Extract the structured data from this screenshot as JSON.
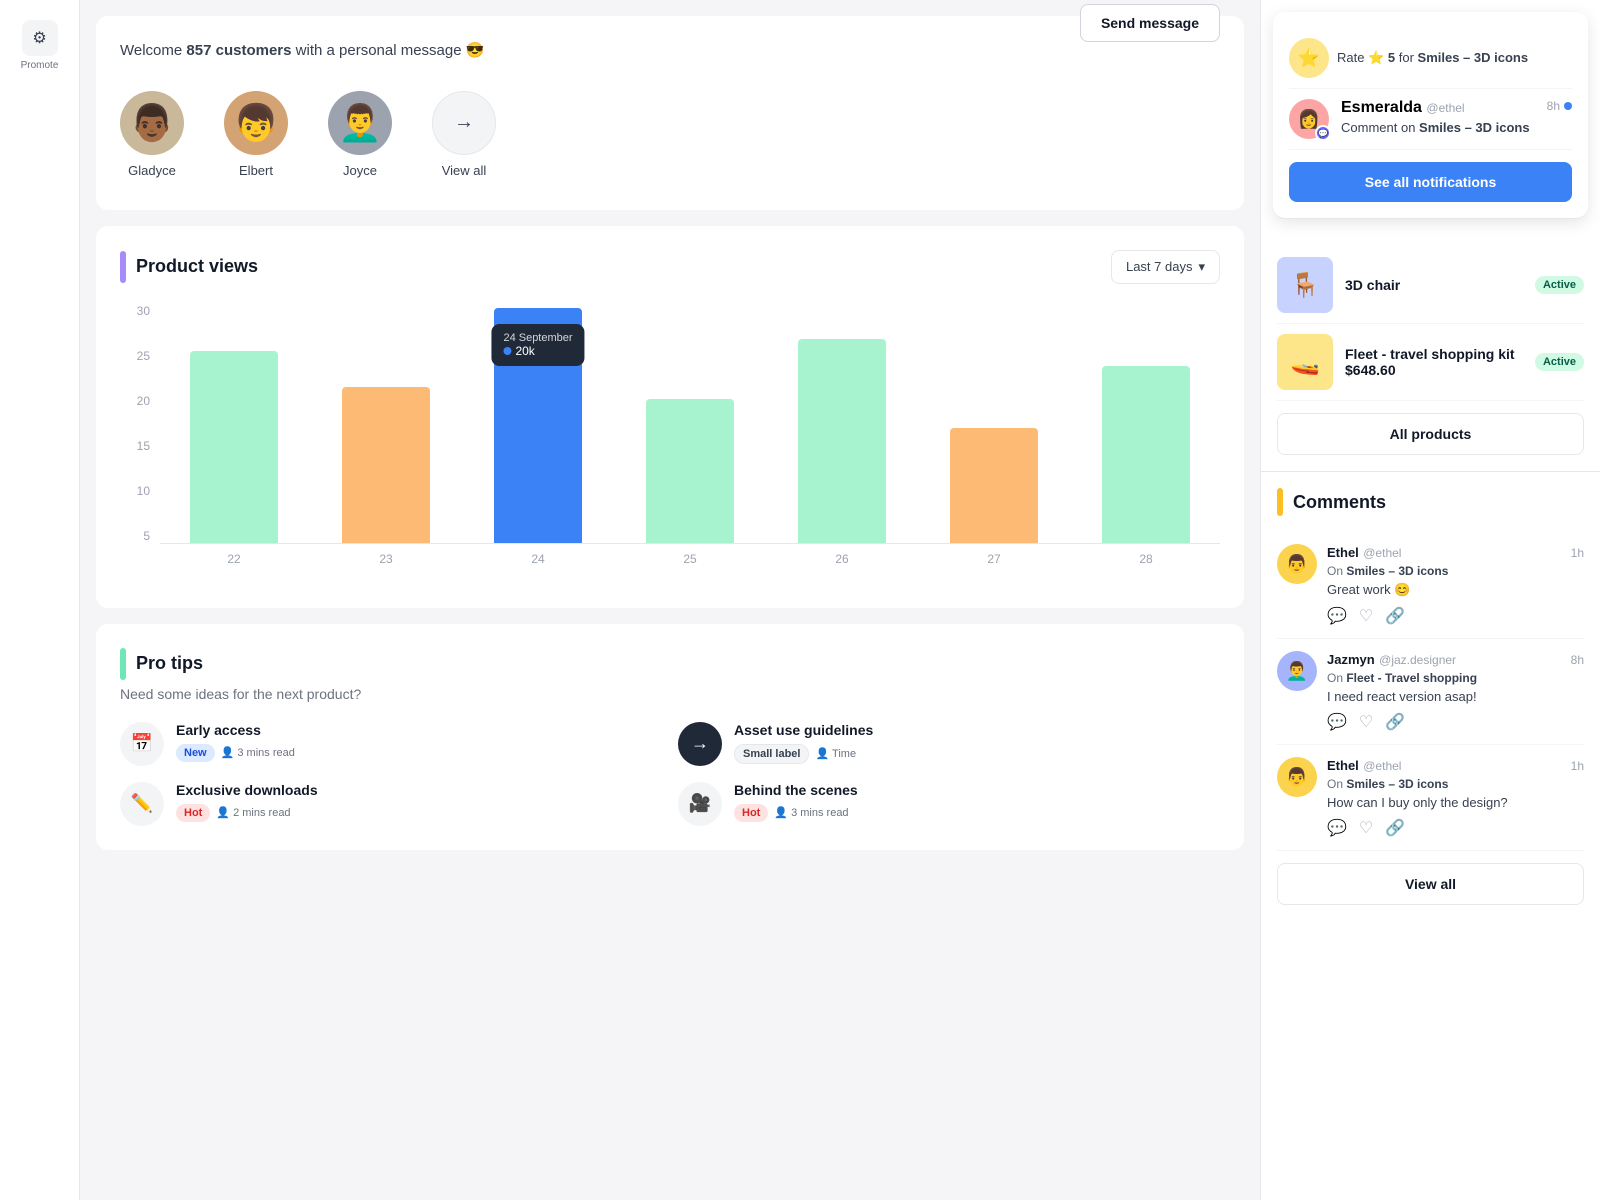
{
  "sidebar": {
    "logo_icon": "⚙",
    "label": "Promote"
  },
  "welcome": {
    "prefix": "Welcome",
    "count": "857 customers",
    "suffix": "with a personal message 😎",
    "send_button": "Send message",
    "avatars": [
      {
        "name": "Gladyce",
        "emoji": "👨🏾"
      },
      {
        "name": "Elbert",
        "emoji": "👦"
      },
      {
        "name": "Joyce",
        "emoji": "👨‍🦱"
      }
    ],
    "view_all_label": "View all"
  },
  "product_views": {
    "title": "Product views",
    "period": "Last 7 days",
    "tooltip": {
      "date": "24 September",
      "value": "20k"
    },
    "y_labels": [
      "5",
      "10",
      "15",
      "20",
      "25",
      "30"
    ],
    "bars": [
      {
        "day": "22",
        "height_pct": 84,
        "type": "green"
      },
      {
        "day": "23",
        "height_pct": 70,
        "type": "orange"
      },
      {
        "day": "24",
        "height_pct": 100,
        "type": "blue"
      },
      {
        "day": "25",
        "height_pct": 63,
        "type": "green"
      },
      {
        "day": "26",
        "height_pct": 88,
        "type": "green"
      },
      {
        "day": "27",
        "height_pct": 50,
        "type": "orange"
      },
      {
        "day": "28",
        "height_pct": 77,
        "type": "green"
      }
    ]
  },
  "pro_tips": {
    "title": "Pro tips",
    "subtitle": "Need some ideas for the next product?",
    "tips": [
      {
        "icon": "📅",
        "title": "Early access",
        "tags": [
          {
            "label": "New",
            "type": "new"
          },
          {
            "label": "3 mins read",
            "type": "read",
            "icon": "👤"
          }
        ]
      },
      {
        "icon": "→",
        "icon_style": "arrow",
        "title": "Asset use guidelines",
        "tags": [
          {
            "label": "Small label",
            "type": "small"
          },
          {
            "label": "Time",
            "type": "time",
            "icon": "👤"
          }
        ]
      },
      {
        "icon": "✏",
        "title": "Exclusive downloads",
        "tags": [
          {
            "label": "Hot",
            "type": "hot"
          },
          {
            "label": "2 mins read",
            "type": "read",
            "icon": "👤"
          }
        ]
      },
      {
        "icon": "🎥",
        "title": "Behind the scenes",
        "tags": [
          {
            "label": "Hot",
            "type": "hot"
          },
          {
            "label": "3 mins read",
            "type": "read",
            "icon": "👤"
          }
        ]
      }
    ]
  },
  "notifications": {
    "items": [
      {
        "avatar": "⭐",
        "text_prefix": "Rate",
        "star": "⭐",
        "number": "5",
        "text_suffix": "for",
        "product": "Smiles – 3D icons"
      },
      {
        "avatar": "👩",
        "name": "Esmeralda",
        "handle": "@ethel",
        "time": "8h",
        "action": "Comment on",
        "product": "Smiles – 3D icons",
        "unread": true
      }
    ],
    "see_all_button": "See all notifications"
  },
  "products": {
    "items": [
      {
        "emoji": "🪑",
        "name": "3D chair",
        "status": "Active",
        "bg": "#c7d2fe"
      },
      {
        "emoji": "🚤",
        "name": "Fleet - travel shopping kit",
        "price": "$648.60",
        "status": "Active",
        "bg": "#fde68a"
      }
    ],
    "all_products_button": "All products"
  },
  "comments": {
    "title": "Comments",
    "items": [
      {
        "avatar": "👨",
        "author": "Ethel",
        "handle": "@ethel",
        "time": "1h",
        "product": "Smiles – 3D icons",
        "text": "Great work 😊",
        "avatar_bg": "#fcd34d"
      },
      {
        "avatar": "👨‍🦱",
        "author": "Jazmyn",
        "handle": "@jaz.designer",
        "time": "8h",
        "product": "Fleet - Travel shopping",
        "text": "I need react version asap!",
        "avatar_bg": "#a5b4fc"
      },
      {
        "avatar": "👨",
        "author": "Ethel",
        "handle": "@ethel",
        "time": "1h",
        "product": "Smiles – 3D icons",
        "text": "How can I buy only the design?",
        "avatar_bg": "#fcd34d"
      }
    ],
    "view_all_button": "View all"
  }
}
